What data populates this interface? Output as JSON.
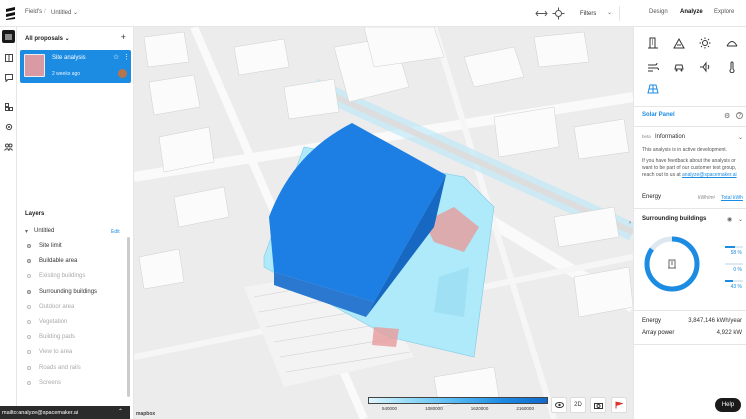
{
  "topbar": {
    "crumbs": [
      "Field's",
      "Untitled"
    ],
    "filters_label": "Filters",
    "modes": [
      "Design",
      "Analyze",
      "Explore"
    ],
    "active_mode": "Analyze"
  },
  "proposals": {
    "header": "All proposals",
    "cards": [
      {
        "title": "Site analysis",
        "subtitle": "2 weeks ago"
      }
    ]
  },
  "layers": {
    "title": "Layers",
    "edit_label": "Edit",
    "root": "Untitled",
    "items": [
      {
        "label": "Site limit",
        "on": true
      },
      {
        "label": "Buildable area",
        "on": true
      },
      {
        "label": "Existing buildings",
        "on": false
      },
      {
        "label": "Surrounding buildings",
        "on": true
      },
      {
        "label": "Outdoor area",
        "on": false
      },
      {
        "label": "Vegetation",
        "on": false
      },
      {
        "label": "Building pads",
        "on": false
      },
      {
        "label": "View to area",
        "on": false
      },
      {
        "label": "Roads and rails",
        "on": false
      },
      {
        "label": "Screens",
        "on": false
      }
    ]
  },
  "statusbar": {
    "text": "mailto:analyze@spacemaker.ai"
  },
  "map": {
    "legend_ticks": [
      "540000",
      "1080000",
      "1620000",
      "2160000"
    ],
    "buttons": [
      "eye",
      "2D",
      "camera",
      "flag"
    ],
    "view_mode": "2D",
    "attribution": "mapbox"
  },
  "analysis": {
    "title": "Solar Panel",
    "beta": "beta",
    "info_label": "Information",
    "info_text": "This analysis is in active development.",
    "feedback_text": "If you have feedback about the analysis or want to be part of our customer test group, reach out to us at",
    "feedback_link": "analyze@spacemaker.ai",
    "energy_label": "Energy",
    "energy_units": [
      "kWh/m²",
      "Total kWh"
    ],
    "energy_unit_active": "Total kWh",
    "surrounding_label": "Surrounding buildings",
    "percentages": [
      {
        "label": "58 %",
        "value": 58
      },
      {
        "label": "0 %",
        "value": 0
      },
      {
        "label": "43 %",
        "value": 43
      }
    ],
    "results": [
      {
        "label": "Energy",
        "value": "3,847,146 kWh/year"
      },
      {
        "label": "Array power",
        "value": "4,922 kW"
      }
    ]
  },
  "help": {
    "label": "Help"
  },
  "colors": {
    "accent": "#1c8ce3",
    "roof": "#1d7fe3",
    "panel": "#8fdcf7",
    "site": "#e79b9b"
  }
}
